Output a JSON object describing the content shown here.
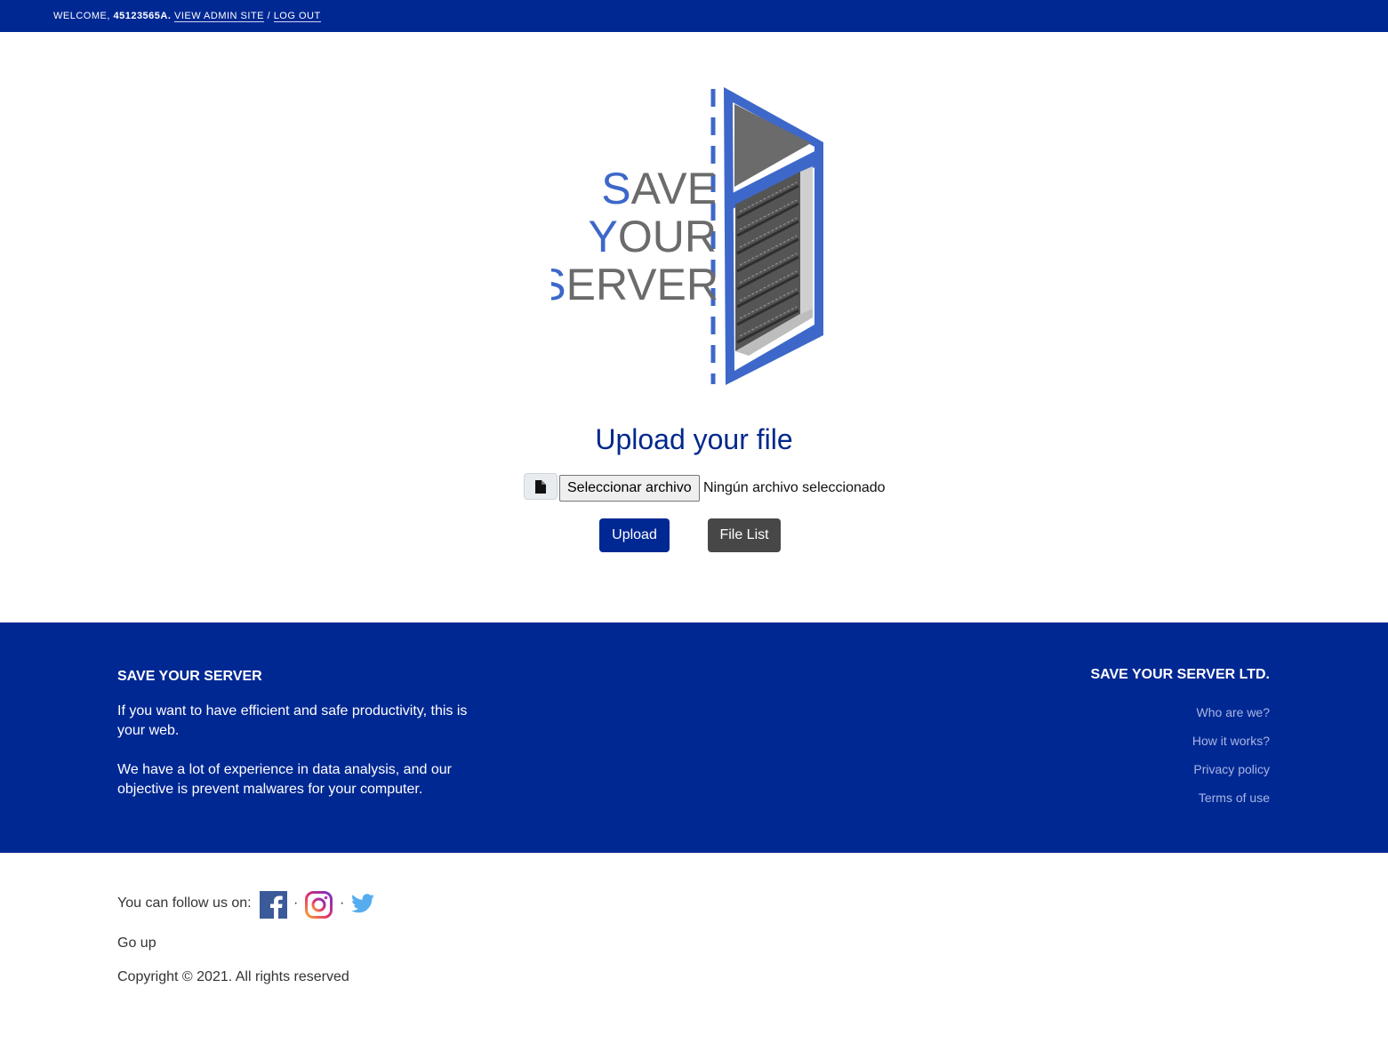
{
  "topbar": {
    "welcome": "Welcome,",
    "user": "45123565A.",
    "admin_link": "View admin site",
    "separator": "/",
    "logout_link": "Log out"
  },
  "logo": {
    "line1_first": "S",
    "line1_rest": "AVE",
    "line2_first": "Y",
    "line2_rest": "OUR",
    "line3_first": "S",
    "line3_rest": "ERVER"
  },
  "upload": {
    "title": "Upload your file",
    "file_button": "Seleccionar archivo",
    "file_status": "Ningún archivo seleccionado",
    "upload_button": "Upload",
    "file_list_button": "File List"
  },
  "footer": {
    "brand": "SAVE YOUR SERVER",
    "paragraph1": "If you want to have efficient and safe productivity, this is your web.",
    "paragraph2": "We have a lot of experience in data analysis, and our objective is prevent malwares for your computer.",
    "company": "SAVE YOUR SERVER LTD.",
    "links": [
      "Who are we?",
      "How it works?",
      "Privacy policy",
      "Terms of use"
    ]
  },
  "bottom": {
    "follow_label": "You can follow us on:",
    "dot": "·",
    "go_up": "Go up",
    "copyright": "Copyright © 2021. All rights reserved"
  },
  "colors": {
    "brand_blue": "#002893",
    "logo_blue": "#3d68c9",
    "dark_button": "#474747"
  }
}
